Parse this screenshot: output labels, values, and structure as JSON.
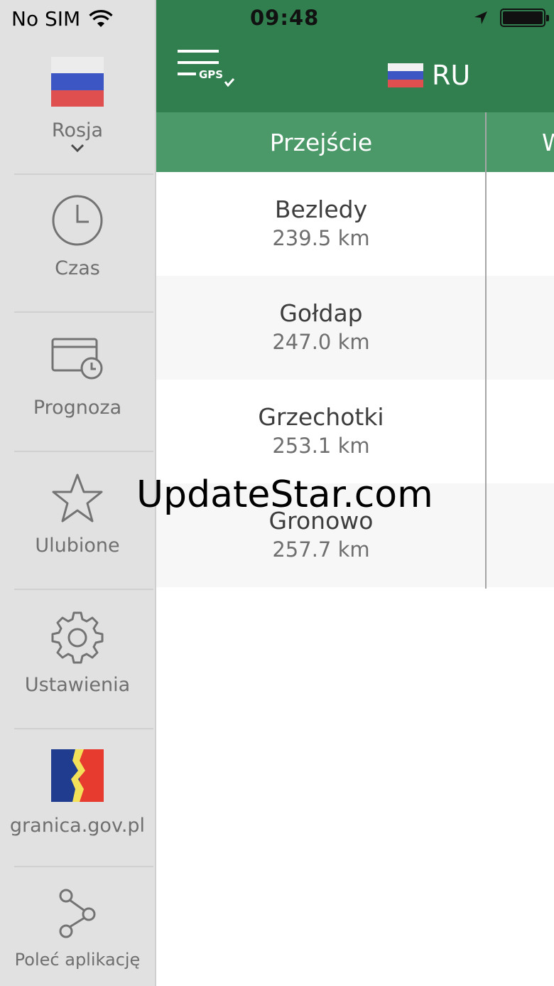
{
  "status_bar": {
    "carrier": "No SIM",
    "time": "09:48"
  },
  "sidebar": {
    "items": [
      {
        "label": "Rosja",
        "icon": "russia-flag-icon"
      },
      {
        "label": "Czas",
        "icon": "clock-icon"
      },
      {
        "label": "Prognoza",
        "icon": "calendar-clock-icon"
      },
      {
        "label": "Ulubione",
        "icon": "star-icon"
      },
      {
        "label": "Ustawienia",
        "icon": "gear-icon"
      },
      {
        "label": "granica.gov.pl",
        "icon": "granica-logo-icon"
      },
      {
        "label": "Poleć aplikację",
        "icon": "share-icon"
      }
    ]
  },
  "header": {
    "menu_badge": "GPS",
    "country_code": "RU"
  },
  "table": {
    "column_header": "Przejście",
    "column_header_2_partial": "W",
    "rows": [
      {
        "name": "Bezledy",
        "distance": "239.5 km"
      },
      {
        "name": "Gołdap",
        "distance": "247.0 km"
      },
      {
        "name": "Grzechotki",
        "distance": "253.1 km"
      },
      {
        "name": "Gronowo",
        "distance": "257.7 km"
      }
    ]
  },
  "watermark": "UpdateStar.com",
  "colors": {
    "header_green": "#317f4f",
    "column_header_green": "#4b9868",
    "sidebar_bg": "#e1e1e1",
    "row_alt": "#f7f7f7"
  }
}
